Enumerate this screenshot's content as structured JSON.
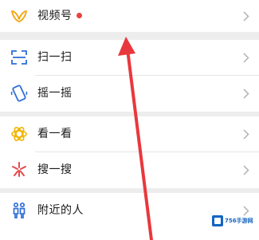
{
  "menu_groups": [
    {
      "items": [
        {
          "label": "视频号",
          "icon": "channels-icon",
          "badge": "dot"
        }
      ]
    },
    {
      "items": [
        {
          "label": "扫一扫",
          "icon": "scan-icon"
        },
        {
          "label": "摇一摇",
          "icon": "shake-icon"
        }
      ]
    },
    {
      "items": [
        {
          "label": "看一看",
          "icon": "top-stories-icon"
        },
        {
          "label": "搜一搜",
          "icon": "search-icon"
        }
      ]
    },
    {
      "items": [
        {
          "label": "附近的人",
          "icon": "people-nearby-icon"
        }
      ]
    }
  ],
  "watermark": {
    "text": "756手游网"
  },
  "colors": {
    "background": "#ededed",
    "card": "#ffffff",
    "badge_dot": "#e64340",
    "annotation_arrow": "#e8383d",
    "chevron": "#b2b2b2"
  }
}
